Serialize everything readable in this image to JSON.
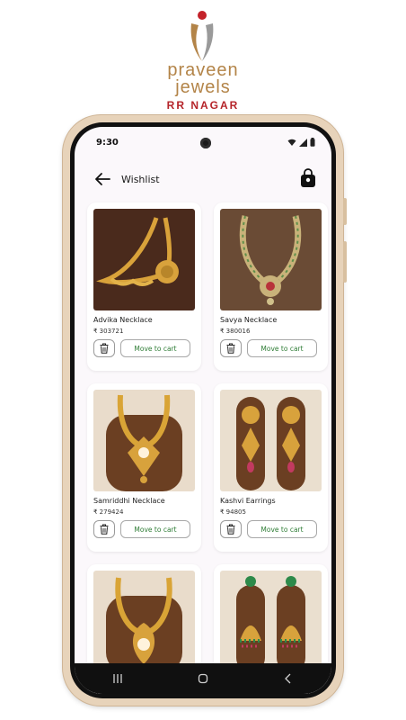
{
  "brand": {
    "line1": "praveen",
    "line2": "jewels",
    "sub": "RR NAGAR",
    "colors": {
      "gold": "#b38448",
      "red": "#b5242a"
    }
  },
  "status_bar": {
    "time": "9:30",
    "icons": [
      "wifi-icon",
      "signal-icon",
      "battery-icon"
    ]
  },
  "app_bar": {
    "title": "Wishlist",
    "back_icon": "arrow-left-icon",
    "bag_icon": "shopping-bag-icon"
  },
  "products": [
    {
      "name": "Advika Necklace",
      "price": "₹ 303721",
      "cart_label": "Move to cart"
    },
    {
      "name": "Savya Necklace",
      "price": "₹ 380016",
      "cart_label": "Move to cart"
    },
    {
      "name": "Samriddhi Necklace",
      "price": "₹ 279424",
      "cart_label": "Move to cart"
    },
    {
      "name": "Kashvi Earrings",
      "price": "₹ 94805",
      "cart_label": "Move to cart"
    },
    {
      "name": "",
      "price": "",
      "cart_label": ""
    },
    {
      "name": "",
      "price": "",
      "cart_label": ""
    }
  ],
  "nav_bar": {
    "buttons": [
      "recents-icon",
      "home-icon",
      "back-chevron-icon"
    ]
  },
  "colors": {
    "accent_green": "#2f7d36",
    "screen_bg": "#fbf8fb"
  }
}
